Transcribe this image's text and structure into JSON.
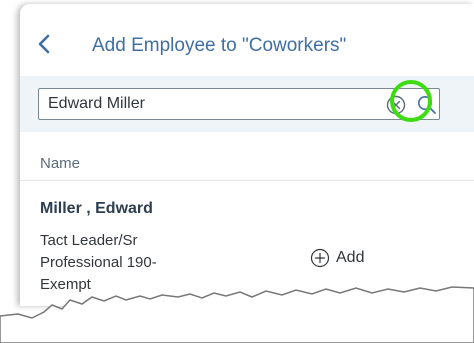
{
  "header": {
    "title": "Add Employee to \"Coworkers\"",
    "back_icon": "chevron-left-icon"
  },
  "search": {
    "value": "Edward Miller",
    "clear_icon": "clear-icon",
    "search_icon": "search-icon",
    "highlight_color": "#3cdc10"
  },
  "table": {
    "column_header": "Name",
    "rows": [
      {
        "name": "Miller , Edward",
        "title": "Tact Leader/Sr Professional 190-Exempt",
        "action_label": "Add",
        "action_icon": "add-circle-icon"
      }
    ]
  },
  "colors": {
    "accent": "#3f6fa3",
    "search_bar_bg": "#eff4f9"
  }
}
